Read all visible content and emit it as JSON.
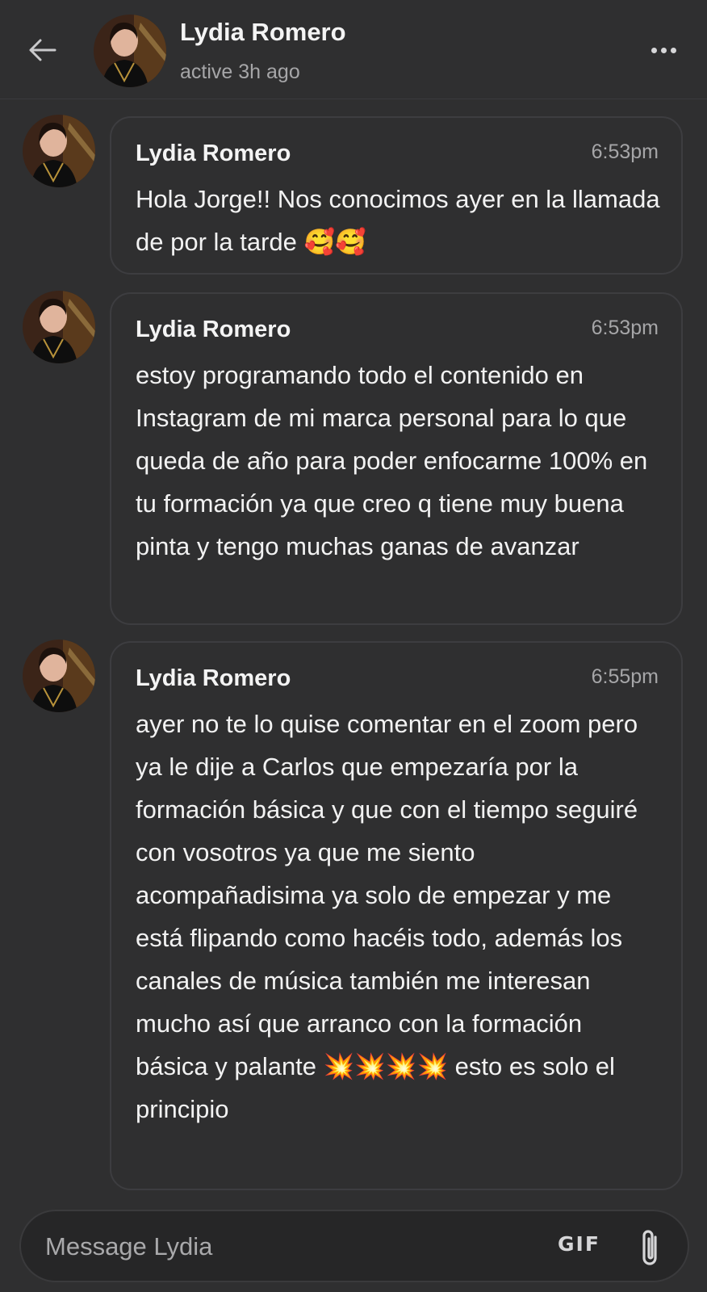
{
  "header": {
    "name": "Lydia Romero",
    "status": "active 3h ago",
    "back_icon": "arrow-left-icon",
    "more_icon": "more-horizontal-icon"
  },
  "messages": [
    {
      "sender": "Lydia Romero",
      "time": "6:53pm",
      "text": "Hola Jorge!! Nos conocimos ayer en la llamada de por la tarde 🥰🥰"
    },
    {
      "sender": "Lydia Romero",
      "time": "6:53pm",
      "text": "estoy programando todo el contenido en Instagram de mi marca personal para lo que queda de año para poder enfocarme 100% en tu formación ya que creo q tiene muy buena pinta y tengo muchas ganas de avanzar"
    },
    {
      "sender": "Lydia Romero",
      "time": "6:55pm",
      "text": "ayer no te lo quise comentar en el zoom pero ya le dije a Carlos que empezaría por la formación básica y que con el tiempo seguiré con vosotros ya que me siento acompañadisima ya solo de empezar y me está flipando como hacéis todo, además los canales de música también me interesan mucho así que arranco con la formación básica y palante 💥💥💥💥 esto es solo el principio"
    }
  ],
  "composer": {
    "placeholder": "Message Lydia",
    "gif_label": "GIF",
    "attach_icon": "paperclip-icon"
  },
  "colors": {
    "background": "#2f2f30",
    "bubble_border": "#3d3d40",
    "secondary_text": "#a6a6a8"
  }
}
